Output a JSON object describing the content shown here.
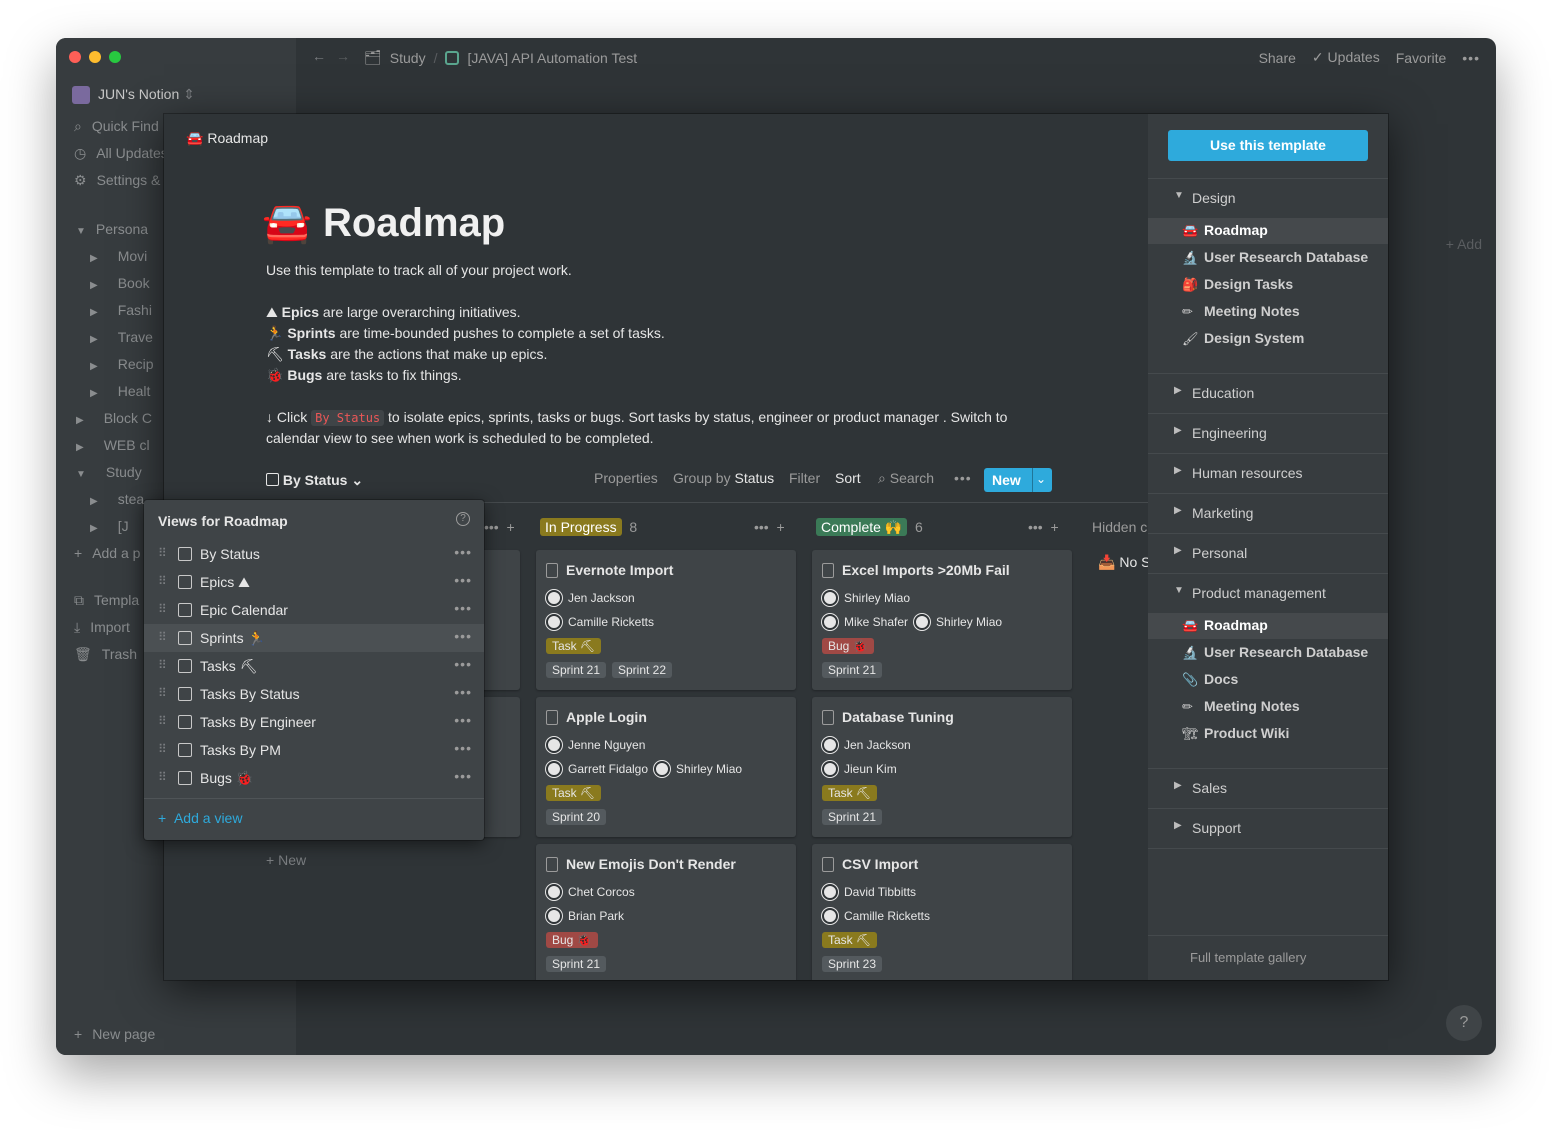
{
  "window": {
    "breadcrumb": [
      {
        "label": "Study"
      },
      {
        "label": "[JAVA] API Automation Test"
      }
    ],
    "topbar_actions": {
      "share": "Share",
      "updates": "Updates",
      "favorite": "Favorite"
    }
  },
  "sidebar": {
    "workspace": "JUN's Notion",
    "quick_find": "Quick Find",
    "all_updates": "All Updates",
    "settings": "Settings &",
    "pages": [
      "Persona",
      "Movi",
      "Book",
      "Fashi",
      "Trave",
      "Recip",
      "Healt",
      "Block C",
      "WEB cl",
      "Study",
      "stea",
      "[J",
      "Add a p"
    ],
    "templates": "Templa",
    "import": "Import",
    "trash": "Trash",
    "new_page": "New page",
    "add": "Add"
  },
  "page": {
    "header_title": "Roadmap",
    "title": "Roadmap",
    "intro": "Use this template to track all of your project work.",
    "bullets": [
      {
        "bold": "Epics",
        "rest": " are large overarching initiatives."
      },
      {
        "bold": "Sprints",
        "rest": " are time-bounded pushes to complete a set of tasks."
      },
      {
        "bold": "Tasks",
        "rest": " are the actions that make up epics."
      },
      {
        "bold": "Bugs",
        "rest": " are tasks to fix things."
      }
    ],
    "click_line_1": "Click",
    "click_code": "By Status",
    "click_line_2": "to isolate epics, sprints, tasks or bugs. Sort tasks by status, engineer or product manager . Switch to",
    "click_line_3": "calendar view to see when work is scheduled to be completed."
  },
  "toolbar": {
    "view": "By Status",
    "properties": "Properties",
    "group_by": "Group by",
    "group_by_value": "Status",
    "filter": "Filter",
    "sort": "Sort",
    "search": "Search",
    "new": "New"
  },
  "board": {
    "columns": [
      {
        "label": "In Progress",
        "count": "8",
        "color": "#8a7a1e"
      },
      {
        "label": "Complete",
        "count": "6",
        "color": "#3b7a57"
      }
    ],
    "hidden_label": "Hidden c",
    "no_status": "No S",
    "new_label": "New",
    "cards": [
      {
        "title": "Evernote Import",
        "people": [
          "Jen Jackson",
          "Camille Ricketts"
        ],
        "type": "Task",
        "sprints": [
          "Sprint 21",
          "Sprint 22"
        ]
      },
      {
        "title": "Apple Login",
        "people": [
          "Jenne Nguyen",
          "Garrett Fidalgo",
          "Shirley Miao"
        ],
        "type": "Task",
        "sprints": [
          "Sprint 20"
        ]
      },
      {
        "title": "New Emojis Don't Render",
        "people": [
          "Chet Corcos",
          "Brian Park"
        ],
        "type": "Bug",
        "sprints": [
          "Sprint 21"
        ]
      },
      {
        "title": "Excel Imports >20Mb Fail",
        "people": [
          "Shirley Miao",
          "Mike Shafer",
          "Shirley Miao"
        ],
        "type": "Bug",
        "sprints": [
          "Sprint 21"
        ]
      },
      {
        "title": "Database Tuning",
        "people": [
          "Jen Jackson",
          "Jieun Kim"
        ],
        "type": "Task",
        "sprints": [
          "Sprint 21"
        ]
      },
      {
        "title": "CSV Import",
        "people": [
          "David Tibbitts",
          "Camille Ricketts"
        ],
        "type": "Task",
        "sprints": [
          "Sprint 23"
        ]
      }
    ]
  },
  "views_popup": {
    "title": "Views for Roadmap",
    "views": [
      "By Status",
      "Epics",
      "Epic Calendar",
      "Sprints",
      "Tasks",
      "Tasks By Status",
      "Tasks By Engineer",
      "Tasks By PM",
      "Bugs"
    ],
    "add_view": "Add a view"
  },
  "template_panel": {
    "use_button": "Use this template",
    "sections": [
      {
        "label": "Design",
        "open": true,
        "items": [
          "Roadmap",
          "User Research Database",
          "Design Tasks",
          "Meeting Notes",
          "Design System"
        ]
      },
      {
        "label": "Education"
      },
      {
        "label": "Engineering"
      },
      {
        "label": "Human resources"
      },
      {
        "label": "Marketing"
      },
      {
        "label": "Personal"
      },
      {
        "label": "Product management",
        "open": true,
        "items": [
          "Roadmap",
          "User Research Database",
          "Docs",
          "Meeting Notes",
          "Product Wiki"
        ]
      },
      {
        "label": "Sales"
      },
      {
        "label": "Support"
      }
    ],
    "gallery": "Full template gallery"
  },
  "help": "?"
}
